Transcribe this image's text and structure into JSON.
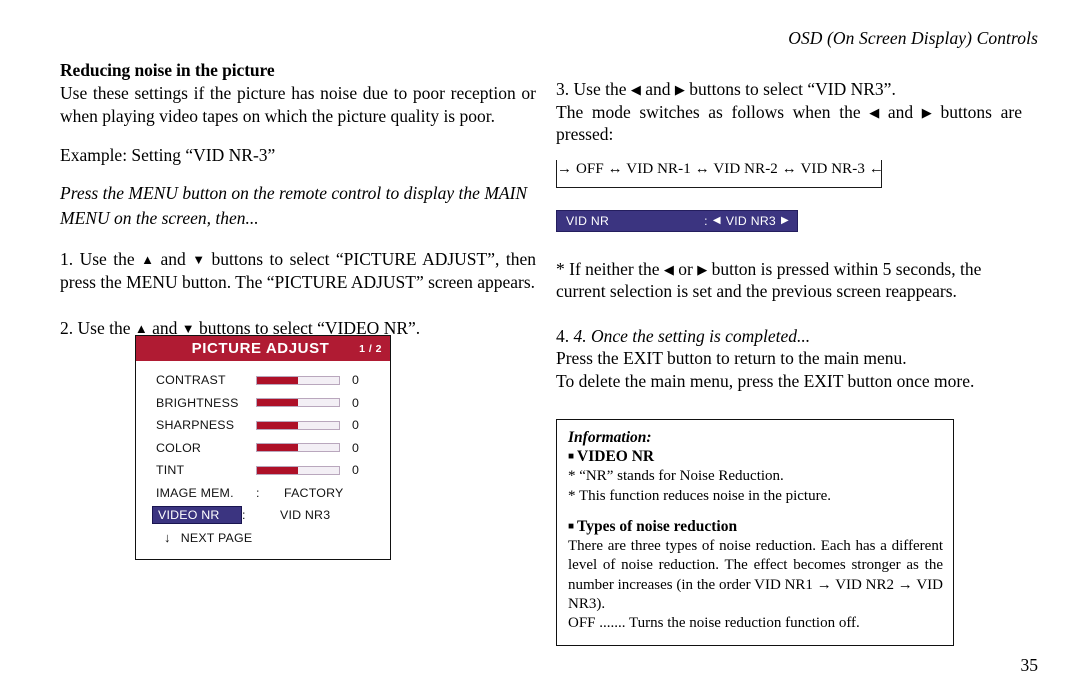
{
  "header": {
    "running_title": "OSD (On Screen Display) Controls"
  },
  "left_column": {
    "section_title": "Reducing noise in the picture",
    "intro_paragraph": "Use these settings if the picture has noise due to poor reception or when playing video tapes on which the picture quality is poor.",
    "example_line": "Example: Setting “VID NR-3”",
    "italic_instruction": "Press the MENU button on the remote control to display the MAIN MENU on the screen, then...",
    "step1_a": "1. Use the ",
    "step1_b": " and ",
    "step1_c": " buttons to select “PICTURE ADJUST”, then press the MENU button. The “PICTURE ADJUST” screen appears.",
    "step2_a": "2. Use the ",
    "step2_b": " and ",
    "step2_c": " buttons to select “VIDEO NR”."
  },
  "osd_panel": {
    "title": "PICTURE ADJUST",
    "page_indicator": "1 / 2",
    "slider_rows": [
      {
        "label": "CONTRAST",
        "fill_percent": 50,
        "value": "0"
      },
      {
        "label": "BRIGHTNESS",
        "fill_percent": 50,
        "value": "0"
      },
      {
        "label": "SHARPNESS",
        "fill_percent": 50,
        "value": "0"
      },
      {
        "label": "COLOR",
        "fill_percent": 50,
        "value": "0"
      },
      {
        "label": "TINT",
        "fill_percent": 50,
        "value": "0"
      }
    ],
    "image_mem": {
      "label": "IMAGE MEM.",
      "colon": ":",
      "value": "FACTORY"
    },
    "video_nr": {
      "label": "VIDEO NR",
      "colon": ":",
      "value": "VID NR3",
      "highlighted": true
    },
    "next_page": {
      "arrow": "↓",
      "label": "NEXT PAGE"
    },
    "colors": {
      "header_bg": "#b01b33",
      "highlight_bg": "#3b3480",
      "slider_fill": "#ae1028",
      "slider_track": "#f3eff5"
    }
  },
  "right_column": {
    "step3_a": "3. Use the ",
    "step3_b": " and ",
    "step3_c": " buttons to select “VID NR3”.",
    "step3_d": "The mode switches as follows when the ",
    "step3_e": " and ",
    "step3_f": " buttons are pressed:",
    "cycle_diagram": {
      "text": "→ OFF ↔ VID NR-1 ↔ VID NR-2 ↔ VID NR-3 ←",
      "modes": [
        "OFF",
        "VID NR-1",
        "VID NR-2",
        "VID NR-3"
      ]
    },
    "vidnr_bar": {
      "label": "VID NR",
      "colon": ":",
      "left_arrow": "◀",
      "value": "VID NR3",
      "right_arrow": "▶",
      "color": "#3b3480"
    },
    "note_a": "* If neither the ",
    "note_b": " or ",
    "note_c": " button is pressed within 5 seconds, the current selection is set and the previous screen reappears.",
    "step4_heading": "4. Once the setting is completed...",
    "step4_line1": "Press the EXIT button to return to the main menu.",
    "step4_line2": "To delete the main menu, press the EXIT button once more."
  },
  "info_box": {
    "heading": "Information:",
    "bullet_glyph": "■",
    "sub1": "VIDEO NR",
    "sub1_line1": "* “NR” stands for Noise Reduction.",
    "sub1_line2": "* This function reduces noise in the picture.",
    "sub2": "Types of noise reduction",
    "sub2_para": "There are three types of noise reduction. Each has a different level of noise reduction. The effect becomes stronger as the number increases (in the order VID NR1 → VID NR2 → VID NR3).",
    "sub2_off": "OFF ....... Turns the noise reduction function off."
  },
  "footer": {
    "page_number": "35"
  }
}
